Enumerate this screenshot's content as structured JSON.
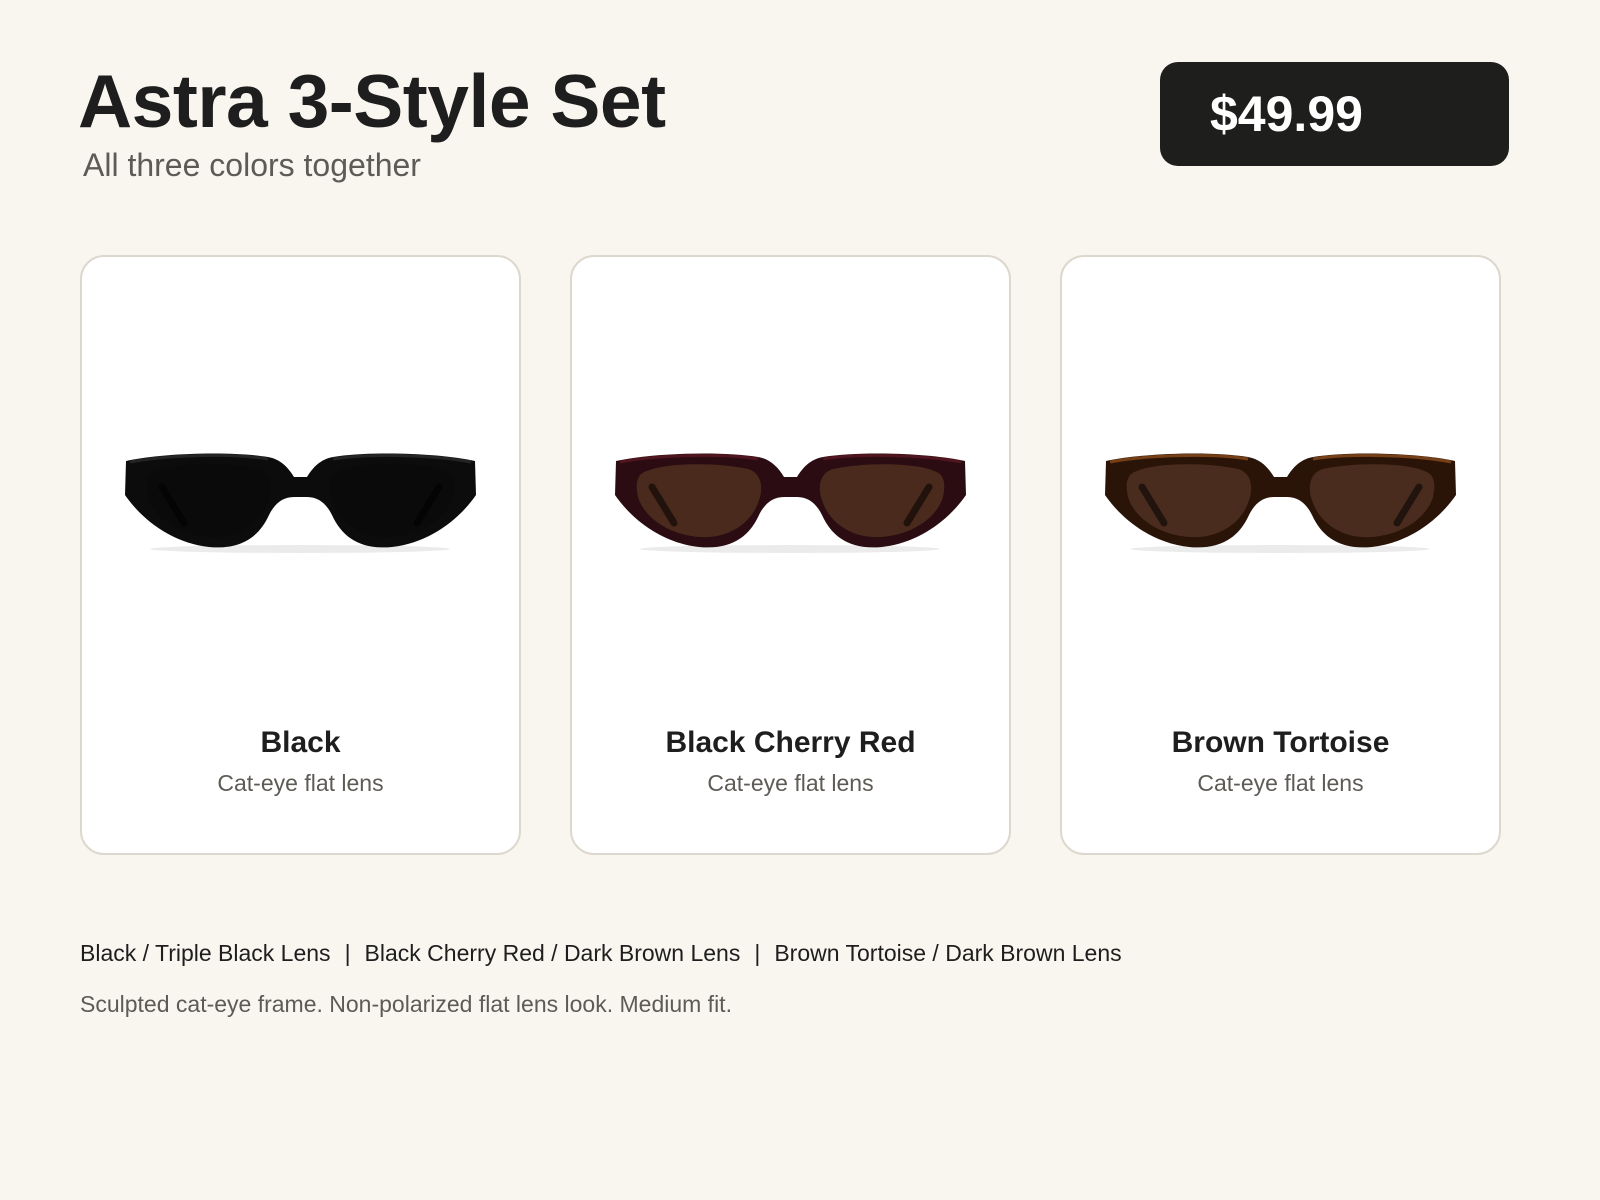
{
  "product": {
    "title": "Astra 3-Style Set",
    "subtitle": "All three colors together",
    "price": "$49.99"
  },
  "cards": [
    {
      "name": "Black",
      "description": "Cat-eye flat lens",
      "image": "sunglasses-black",
      "frame_color": "#0c0c0c",
      "lens_color": "#0a0a0a",
      "accent_color": "#2a2a2a"
    },
    {
      "name": "Black Cherry Red",
      "description": "Cat-eye flat lens",
      "image": "sunglasses-black-cherry-red",
      "frame_color": "#2a0c12",
      "lens_color": "#4a2a1c",
      "accent_color": "#5a1822"
    },
    {
      "name": "Brown Tortoise",
      "description": "Cat-eye flat lens",
      "image": "sunglasses-brown-tortoise",
      "frame_color": "#2a1408",
      "lens_color": "#4a2c1e",
      "accent_color": "#8a4a1a"
    }
  ],
  "variants": [
    "Black / Triple Black Lens",
    "Black Cherry Red / Dark Brown Lens",
    "Brown Tortoise / Dark Brown Lens"
  ],
  "variant_separator": "|",
  "description": "Sculpted cat-eye frame. Non-polarized flat lens look. Medium fit."
}
